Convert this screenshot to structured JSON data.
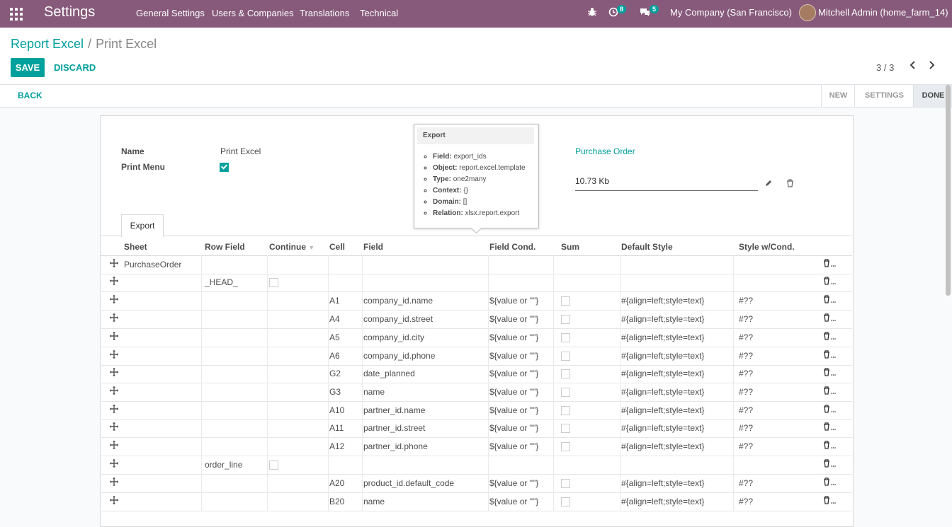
{
  "navbar": {
    "brand": "Settings",
    "menu": [
      "General Settings",
      "Users & Companies",
      "Translations",
      "Technical"
    ],
    "activity_count": "8",
    "messages_count": "5",
    "company": "My Company (San Francisco)",
    "user": "Mitchell Admin (home_farm_14)"
  },
  "breadcrumb": {
    "parent": "Report Excel",
    "separator": "/",
    "current": "Print Excel"
  },
  "buttons": {
    "save": "SAVE",
    "discard": "DISCARD",
    "back": "BACK"
  },
  "pager": {
    "value": "3 / 3"
  },
  "stages": [
    "NEW",
    "SETTINGS",
    "DONE"
  ],
  "form": {
    "name_label": "Name",
    "name_value": "Print Excel",
    "print_menu_label": "Print Menu",
    "print_menu_checked": true,
    "model_link": "Purchase Order",
    "file_size": "10.73 Kb"
  },
  "tooltip": {
    "title": "Export",
    "items": [
      {
        "k": "Field:",
        "v": "export_ids"
      },
      {
        "k": "Object:",
        "v": "report.excel.template"
      },
      {
        "k": "Type:",
        "v": "one2many"
      },
      {
        "k": "Context:",
        "v": "{}"
      },
      {
        "k": "Domain:",
        "v": "[]"
      },
      {
        "k": "Relation:",
        "v": "xlsx.report.export"
      }
    ]
  },
  "tab": {
    "label": "Export"
  },
  "table": {
    "headers": [
      "Sheet",
      "Row Field",
      "Continue",
      "Cell",
      "Field",
      "Field Cond.",
      "Sum",
      "Default Style",
      "Style w/Cond."
    ],
    "rows": [
      {
        "sheet": "PurchaseOrder",
        "row_field": "",
        "continue": null,
        "cell": "",
        "field": "",
        "cond": "",
        "sum": null,
        "style": "",
        "style_cond": ""
      },
      {
        "sheet": "",
        "row_field": "_HEAD_",
        "continue": false,
        "cell": "",
        "field": "",
        "cond": "",
        "sum": null,
        "style": "",
        "style_cond": ""
      },
      {
        "sheet": "",
        "row_field": "",
        "continue": null,
        "cell": "A1",
        "field": "company_id.name",
        "cond": "${value or \"\"}",
        "sum": false,
        "style": "#{align=left;style=text}",
        "style_cond": "#??"
      },
      {
        "sheet": "",
        "row_field": "",
        "continue": null,
        "cell": "A4",
        "field": "company_id.street",
        "cond": "${value or \"\"}",
        "sum": false,
        "style": "#{align=left;style=text}",
        "style_cond": "#??"
      },
      {
        "sheet": "",
        "row_field": "",
        "continue": null,
        "cell": "A5",
        "field": "company_id.city",
        "cond": "${value or \"\"}",
        "sum": false,
        "style": "#{align=left;style=text}",
        "style_cond": "#??"
      },
      {
        "sheet": "",
        "row_field": "",
        "continue": null,
        "cell": "A6",
        "field": "company_id.phone",
        "cond": "${value or \"\"}",
        "sum": false,
        "style": "#{align=left;style=text}",
        "style_cond": "#??"
      },
      {
        "sheet": "",
        "row_field": "",
        "continue": null,
        "cell": "G2",
        "field": "date_planned",
        "cond": "${value or \"\"}",
        "sum": false,
        "style": "#{align=left;style=text}",
        "style_cond": "#??"
      },
      {
        "sheet": "",
        "row_field": "",
        "continue": null,
        "cell": "G3",
        "field": "name",
        "cond": "${value or \"\"}",
        "sum": false,
        "style": "#{align=left;style=text}",
        "style_cond": "#??"
      },
      {
        "sheet": "",
        "row_field": "",
        "continue": null,
        "cell": "A10",
        "field": "partner_id.name",
        "cond": "${value or \"\"}",
        "sum": false,
        "style": "#{align=left;style=text}",
        "style_cond": "#??"
      },
      {
        "sheet": "",
        "row_field": "",
        "continue": null,
        "cell": "A11",
        "field": "partner_id.street",
        "cond": "${value or \"\"}",
        "sum": false,
        "style": "#{align=left;style=text}",
        "style_cond": "#??"
      },
      {
        "sheet": "",
        "row_field": "",
        "continue": null,
        "cell": "A12",
        "field": "partner_id.phone",
        "cond": "${value or \"\"}",
        "sum": false,
        "style": "#{align=left;style=text}",
        "style_cond": "#??"
      },
      {
        "sheet": "",
        "row_field": "order_line",
        "continue": false,
        "cell": "",
        "field": "",
        "cond": "",
        "sum": null,
        "style": "",
        "style_cond": ""
      },
      {
        "sheet": "",
        "row_field": "",
        "continue": null,
        "cell": "A20",
        "field": "product_id.default_code",
        "cond": "${value or \"\"}",
        "sum": false,
        "style": "#{align=left;style=text}",
        "style_cond": "#??"
      },
      {
        "sheet": "",
        "row_field": "",
        "continue": null,
        "cell": "B20",
        "field": "name",
        "cond": "${value or \"\"}",
        "sum": false,
        "style": "#{align=left;style=text}",
        "style_cond": "#??"
      }
    ]
  },
  "colors": {
    "brand": "#875a7b",
    "accent": "#00a09d"
  }
}
